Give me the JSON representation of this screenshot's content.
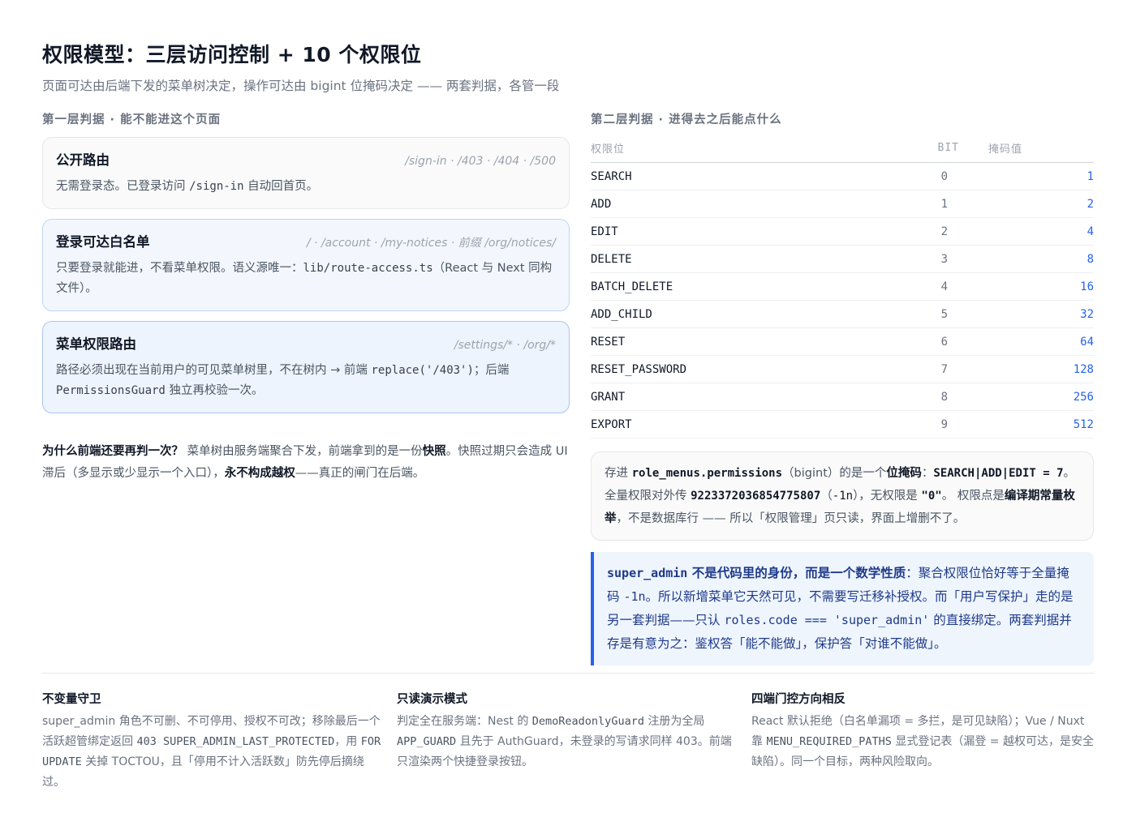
{
  "header": {
    "title": "权限模型：三层访问控制 + 10 个权限位",
    "subtitle": "页面可达由后端下发的菜单树决定，操作可达由 bigint 位掩码决定 —— 两套判据，各管一段"
  },
  "left": {
    "section_label": "第一层判据 · 能不能进这个页面",
    "cards": [
      {
        "title": "公开路由",
        "path": "/sign-in · /403 · /404 · /500",
        "body_1": "无需登录态。已登录访问 ",
        "body_code": "/sign-in",
        "body_2": " 自动回首页。"
      },
      {
        "title": "登录可达白名单",
        "path": "/ · /account · /my-notices · 前缀 /org/notices/",
        "body_1": "只要登录就能进，不看菜单权限。语义源唯一：",
        "body_code": "lib/route-access.ts",
        "body_2": "（React 与 Next 同构文件）。"
      },
      {
        "title": "菜单权限路由",
        "path": "/settings/* · /org/*",
        "body_1": "路径必须出现在当前用户的可见菜单树里，不在树内 → 前端 ",
        "body_code": "replace('/403')",
        "body_2": "；后端 ",
        "body_code_2": "PermissionsGuard",
        "body_3": " 独立再校验一次。"
      }
    ],
    "why": {
      "q": "为什么前端还要再判一次？",
      "t1": " 菜单树由服务端聚合下发，前端拿到的是一份",
      "b1": "快照",
      "t2": "。快照过期只会造成 UI 滞后（多显示或少显示一个入口），",
      "b2": "永不构成越权",
      "t3": "——真正的闸门在后端。"
    }
  },
  "right": {
    "section_label": "第二层判据 · 进得去之后能点什么",
    "columns": {
      "name": "权限位",
      "bit": "BIT",
      "mask": "掩码值"
    },
    "rows": [
      {
        "name": "SEARCH",
        "bit": "0",
        "mask": "1"
      },
      {
        "name": "ADD",
        "bit": "1",
        "mask": "2"
      },
      {
        "name": "EDIT",
        "bit": "2",
        "mask": "4"
      },
      {
        "name": "DELETE",
        "bit": "3",
        "mask": "8"
      },
      {
        "name": "BATCH_DELETE",
        "bit": "4",
        "mask": "16"
      },
      {
        "name": "ADD_CHILD",
        "bit": "5",
        "mask": "32"
      },
      {
        "name": "RESET",
        "bit": "6",
        "mask": "64"
      },
      {
        "name": "RESET_PASSWORD",
        "bit": "7",
        "mask": "128"
      },
      {
        "name": "GRANT",
        "bit": "8",
        "mask": "256"
      },
      {
        "name": "EXPORT",
        "bit": "9",
        "mask": "512"
      }
    ],
    "note": {
      "t1": "存进 ",
      "c1": "role_menus.permissions",
      "t2": "（bigint）的是一个",
      "b1": "位掩码",
      "t3": "：",
      "c2": "SEARCH|ADD|EDIT = 7",
      "t4": "。全量权限对外传 ",
      "c3": "9223372036854775807",
      "t5": "（",
      "c4": "-1n",
      "t6": "），无权限是 ",
      "c5": "\"0\"",
      "t7": "。 权限点是",
      "b2": "编译期常量枚举",
      "t8": "，不是数据库行 —— 所以「权限管理」页只读，界面上增删不了。"
    },
    "callout": {
      "c1": "super_admin",
      "b1": " 不是代码里的身份，而是一个数学性质",
      "t1": "：聚合权限位恰好等于全量掩码 ",
      "c2": "-1n",
      "t2": "。所以新增菜单它天然可见，不需要写迁移补授权。而「用户写保护」走的是另一套判据——只认 ",
      "c3": "roles.code === 'super_admin'",
      "t3": " 的直接绑定。两套判据并存是有意为之：鉴权答「能不能做」，保护答「对谁不能做」。"
    }
  },
  "footer": [
    {
      "title": "不变量守卫",
      "t1": "super_admin 角色不可删、不可停用、授权不可改；移除最后一个活跃超管绑定返回 ",
      "c1": "403 SUPER_ADMIN_LAST_PROTECTED",
      "t2": "，用 ",
      "c2": "FOR UPDATE",
      "t3": " 关掉 TOCTOU，且「停用不计入活跃数」防先停后摘绕过。"
    },
    {
      "title": "只读演示模式",
      "t1": "判定全在服务端：Nest 的 ",
      "c1": "DemoReadonlyGuard",
      "t2": " 注册为全局 ",
      "c2": "APP_GUARD",
      "t3": " 且先于 AuthGuard，未登录的写请求同样 403。前端只渲染两个快捷登录按钮。"
    },
    {
      "title": "四端门控方向相反",
      "t1": "React 默认拒绝（白名单漏项 = 多拦，是可见缺陷）；Vue / Nuxt 靠 ",
      "c1": "MENU_REQUIRED_PATHS",
      "t2": " 显式登记表（漏登 = 越权可达，是安全缺陷）。同一个目标，两种风险取向。"
    }
  ]
}
